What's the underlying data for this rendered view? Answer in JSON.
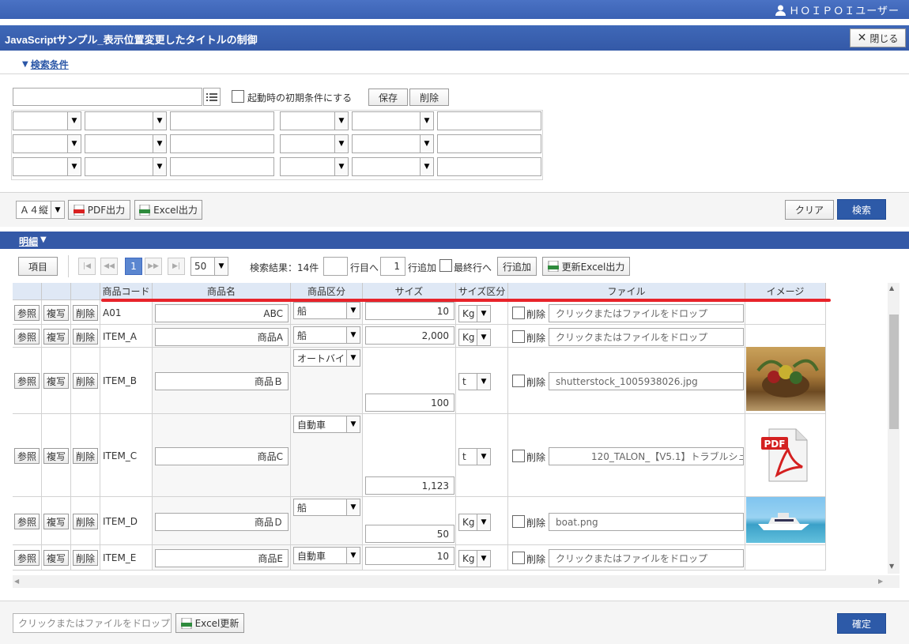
{
  "header": {
    "user": "ＨＯＩＰＯＩユーザー"
  },
  "titlebar": {
    "title": "JavaScriptサンプル_表示位置変更したタイトルの制御",
    "close_label": "閉じる"
  },
  "search": {
    "toggle_label": "検索条件",
    "condition_name_value": "",
    "default_checkbox_label": "起動時の初期条件にする",
    "save_label": "保存",
    "delete_label": "削除"
  },
  "toolbar": {
    "paper_select": "Ａ４縦",
    "pdf_label": "PDF出力",
    "excel_label": "Excel出力",
    "clear_label": "クリア",
    "search_label": "検索"
  },
  "detail": {
    "title": "明細",
    "items_label": "項目",
    "current_page": "1",
    "page_size": "50",
    "result_text": "検索結果：14件",
    "goto_row_value": "",
    "goto_row_label": "行目へ",
    "add_count_value": "1",
    "add_rows_label": "行追加",
    "last_row_label": "最終行へ",
    "add_row_button": "行追加",
    "update_excel_label": "更新Excel出力"
  },
  "grid": {
    "columns": [
      "商品コード",
      "商品名",
      "商品区分",
      "サイズ",
      "サイズ区分",
      "ファイル",
      "イメージ"
    ],
    "row_buttons": {
      "ref": "参照",
      "copy": "複写",
      "del": "削除"
    },
    "file_delete_label": "削除",
    "rows": [
      {
        "code": "A01",
        "name": "ABC",
        "category": "船",
        "size": "10",
        "unit": "Kg",
        "file": "クリックまたはファイルをドロップ",
        "file_is_placeholder": true
      },
      {
        "code": "ITEM_A",
        "name": "商品A",
        "category": "船",
        "size": "2,000",
        "unit": "Kg",
        "file": "クリックまたはファイルをドロップ",
        "file_is_placeholder": true
      },
      {
        "code": "ITEM_B",
        "name": "商品Ｂ",
        "category": "オートバイ",
        "size": "100",
        "unit": "t",
        "file": "shutterstock_1005938026.jpg",
        "file_is_placeholder": false
      },
      {
        "code": "ITEM_C",
        "name": "商品C",
        "category": "自動車",
        "size": "1,123",
        "unit": "t",
        "file": "120_TALON_【V5.1】トラブルシュ",
        "file_is_placeholder": false
      },
      {
        "code": "ITEM_D",
        "name": "商品Ｄ",
        "category": "船",
        "size": "50",
        "unit": "Kg",
        "file": "boat.png",
        "file_is_placeholder": false
      },
      {
        "code": "ITEM_E",
        "name": "商品E",
        "category": "自動車",
        "size": "10",
        "unit": "Kg",
        "file": "クリックまたはファイルをドロップ",
        "file_is_placeholder": true
      }
    ],
    "image_labels": {
      "pdf": "PDF"
    }
  },
  "footer": {
    "drop_label": "クリックまたはファイルをドロップ",
    "excel_update_label": "Excel更新",
    "confirm_label": "確定"
  },
  "colors": {
    "accent": "#3459a7",
    "highlight_line": "#e8232a"
  }
}
